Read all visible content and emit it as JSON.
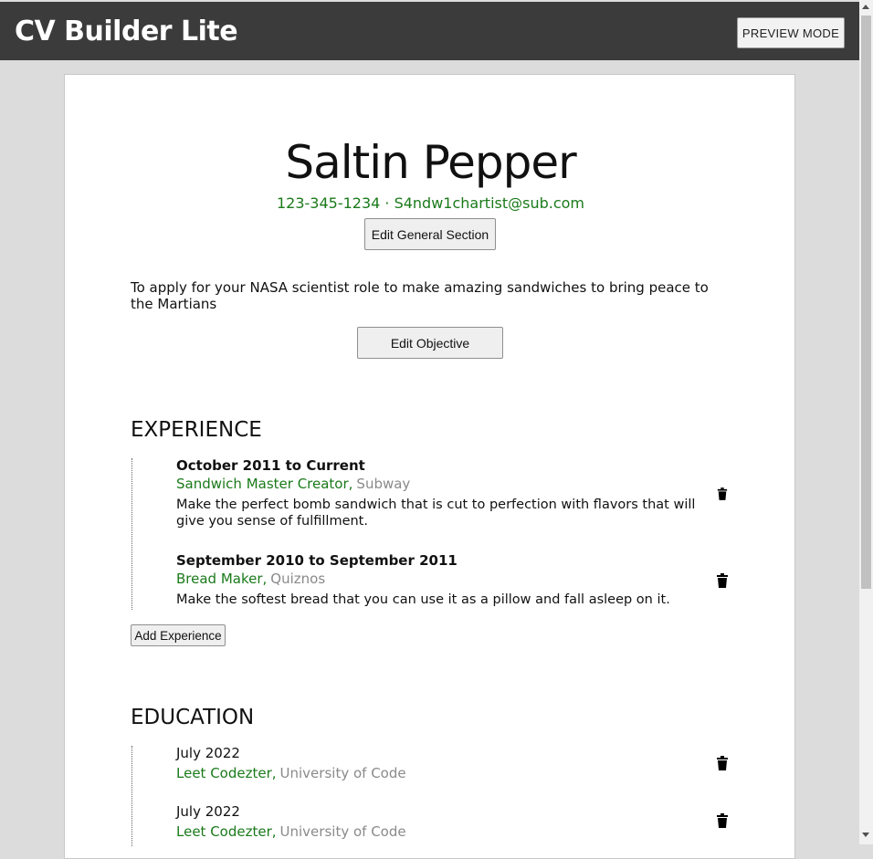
{
  "app": {
    "title": "CV Builder Lite",
    "preview_label": "PREVIEW MODE"
  },
  "general": {
    "name": "Saltin Pepper",
    "contact": "123-345-1234 · S4ndw1chartist@sub.com",
    "edit_label": "Edit General Section"
  },
  "objective": {
    "text": "To apply for your NASA scientist role to make amazing sandwiches to bring peace to the Martians",
    "edit_label": "Edit Objective"
  },
  "experience": {
    "heading": "EXPERIENCE",
    "add_label": "Add Experience",
    "items": [
      {
        "dates": "October 2011 to Current",
        "role": "Sandwich Master Creator,",
        "org": "Subway",
        "desc": "Make the perfect bomb sandwich that is cut to perfection with flavors that will give you sense of fulfillment."
      },
      {
        "dates": "September 2010 to September 2011",
        "role": "Bread Maker,",
        "org": "Quiznos",
        "desc": "Make the softest bread that you can use it as a pillow and fall asleep on it."
      }
    ]
  },
  "education": {
    "heading": "EDUCATION",
    "items": [
      {
        "dates": "July 2022",
        "role": "Leet Codezter,",
        "org": "University of Code"
      },
      {
        "dates": "July 2022",
        "role": "Leet Codezter,",
        "org": "University of Code"
      }
    ]
  },
  "icons": {
    "delete": "trash-icon",
    "scroll_up": "chevron-up-icon",
    "scroll_down": "chevron-down-icon"
  },
  "colors": {
    "header_bg": "#3b3b3b",
    "accent_green": "#1a7a1a",
    "org_gray": "#8a8a8a",
    "page_bg": "#dcdcdc"
  }
}
